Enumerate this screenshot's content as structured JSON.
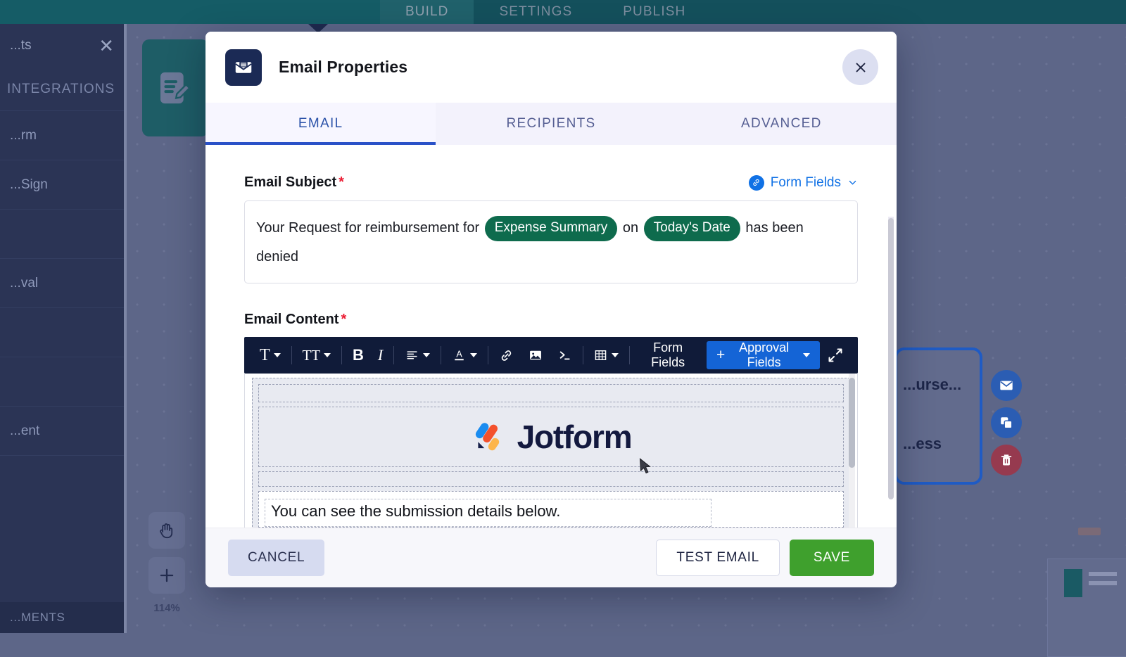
{
  "app": {
    "top_nav": {
      "tabs": [
        {
          "label": "BUILD",
          "active": true
        },
        {
          "label": "SETTINGS",
          "active": false
        },
        {
          "label": "PUBLISH",
          "active": false
        }
      ]
    },
    "left_panel": {
      "title": "...ts",
      "close_icon": "close-icon",
      "tab_label": "INTEGRATIONS",
      "items": [
        {
          "label": "...rm"
        },
        {
          "label": "...Sign"
        },
        {
          "label": ""
        },
        {
          "label": "...val"
        },
        {
          "label": ""
        },
        {
          "label": ""
        },
        {
          "label": "...ent"
        }
      ],
      "footer_label": "...MENTS"
    },
    "canvas": {
      "start_node_icon": "form-sign-icon",
      "selected_node": {
        "line1": "...urse...",
        "line2": "...ess"
      },
      "node_actions": [
        {
          "icon": "envelope-icon",
          "name": "email-action"
        },
        {
          "icon": "duplicate-icon",
          "name": "duplicate-action"
        },
        {
          "icon": "trash-icon",
          "name": "delete-action"
        }
      ],
      "zoom_tools": {
        "pan_icon": "hand-icon",
        "zoom_in_label": "+",
        "zoom_percent": "114%"
      }
    }
  },
  "modal": {
    "title": "Email Properties",
    "header_icon": "envelope-properties-icon",
    "close_icon": "close-icon",
    "tabs": [
      {
        "label": "EMAIL",
        "active": true
      },
      {
        "label": "RECIPIENTS",
        "active": false
      },
      {
        "label": "ADVANCED",
        "active": false
      }
    ],
    "subject": {
      "label": "Email Subject",
      "required_mark": "*",
      "form_fields_label": "Form Fields",
      "form_fields_icon": "link-icon",
      "form_fields_chevron": "chevron-down-icon",
      "parts": [
        {
          "type": "text",
          "value": "Your Request for reimbursement for "
        },
        {
          "type": "token",
          "value": "Expense Summary"
        },
        {
          "type": "text",
          "value": " on "
        },
        {
          "type": "token",
          "value": "Today's Date"
        },
        {
          "type": "text",
          "value": " has been denied"
        }
      ],
      "token_color": "#0e6b4d"
    },
    "content": {
      "label": "Email Content",
      "required_mark": "*",
      "toolbar": [
        {
          "name": "text-style-button",
          "glyph": "T",
          "caret": true
        },
        {
          "name": "font-size-button",
          "glyph": "TT",
          "caret": true
        },
        {
          "name": "bold-button",
          "glyph": "B",
          "caret": false
        },
        {
          "name": "italic-button",
          "glyph": "I",
          "caret": false
        },
        {
          "name": "align-button",
          "glyph": "align-icon",
          "caret": true
        },
        {
          "name": "text-color-button",
          "glyph": "A-underline-icon",
          "caret": true
        },
        {
          "name": "link-button",
          "glyph": "link-icon",
          "caret": false
        },
        {
          "name": "image-button",
          "glyph": "image-icon",
          "caret": false
        },
        {
          "name": "source-code-button",
          "glyph": "code-icon",
          "caret": false
        },
        {
          "name": "table-button",
          "glyph": "table-icon",
          "caret": true
        }
      ],
      "form_fields_button": "Form Fields",
      "approval_fields_button": "Approval Fields",
      "approval_fields_plus": "+",
      "approval_fields_color": "#1464d6",
      "expand_icon": "expand-icon",
      "body": {
        "logo_text": "Jotform",
        "logo_colors": [
          "#1a8cf0",
          "#f4512c",
          "#fdb54b",
          "#16204a"
        ],
        "paragraph": "You can see the submission details below."
      }
    },
    "footer": {
      "cancel_label": "CANCEL",
      "test_email_label": "TEST EMAIL",
      "save_label": "SAVE",
      "save_color": "#3fa02d"
    }
  }
}
